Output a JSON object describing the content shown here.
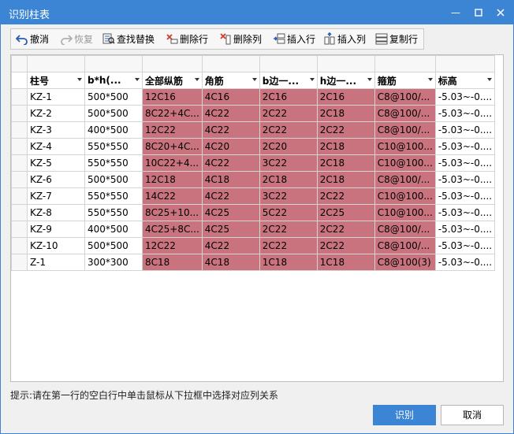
{
  "window": {
    "title": "识别柱表",
    "accent": "#3c84d4"
  },
  "toolbar": {
    "undo": "撤消",
    "redo": "恢复",
    "find_replace": "查找替换",
    "delete_row": "删除行",
    "delete_col": "删除列",
    "insert_row": "插入行",
    "insert_col": "插入列",
    "copy_row": "复制行"
  },
  "table": {
    "highlight_color": "#c9737f",
    "headers": [
      "柱号",
      "b*h(...",
      "全部纵筋",
      "角筋",
      "b边一...",
      "h边一...",
      "箍筋",
      "标高"
    ],
    "rows": [
      [
        "KZ-1",
        "500*500",
        "12C16",
        "4C16",
        "2C16",
        "2C16",
        "C8@100/...",
        "-5.03~-0...."
      ],
      [
        "KZ-2",
        "500*500",
        "8C22+4C...",
        "4C22",
        "2C22",
        "2C18",
        "C8@100/...",
        "-5.03~-0...."
      ],
      [
        "KZ-3",
        "400*500",
        "12C22",
        "4C22",
        "2C22",
        "2C22",
        "C8@100/...",
        "-5.03~-0...."
      ],
      [
        "KZ-4",
        "550*550",
        "8C20+4C...",
        "4C20",
        "2C20",
        "2C18",
        "C10@100...",
        "-5.03~-0...."
      ],
      [
        "KZ-5",
        "550*550",
        "10C22+4...",
        "4C22",
        "3C22",
        "2C18",
        "C10@100...",
        "-5.03~-0...."
      ],
      [
        "KZ-6",
        "500*500",
        "12C18",
        "4C18",
        "2C18",
        "2C18",
        "C8@100/...",
        "-5.03~-0...."
      ],
      [
        "KZ-7",
        "550*550",
        "14C22",
        "4C22",
        "3C22",
        "2C22",
        "C10@100...",
        "-5.03~-0...."
      ],
      [
        "KZ-8",
        "550*550",
        "8C25+10...",
        "4C25",
        "5C22",
        "2C25",
        "C10@100...",
        "-5.03~-0...."
      ],
      [
        "KZ-9",
        "400*500",
        "4C25+8C...",
        "4C25",
        "2C22",
        "2C22",
        "C8@100/...",
        "-5.03~-0...."
      ],
      [
        "KZ-10",
        "500*500",
        "12C22",
        "4C22",
        "2C22",
        "2C22",
        "C8@100/...",
        "-5.03~-0...."
      ],
      [
        "Z-1",
        "300*300",
        "8C18",
        "4C18",
        "1C18",
        "1C18",
        "C8@100(3)",
        "-5.03~-0...."
      ]
    ]
  },
  "hint": "提示:请在第一行的空白行中单击鼠标从下拉框中选择对应列关系",
  "buttons": {
    "ok": "识别",
    "cancel": "取消"
  }
}
